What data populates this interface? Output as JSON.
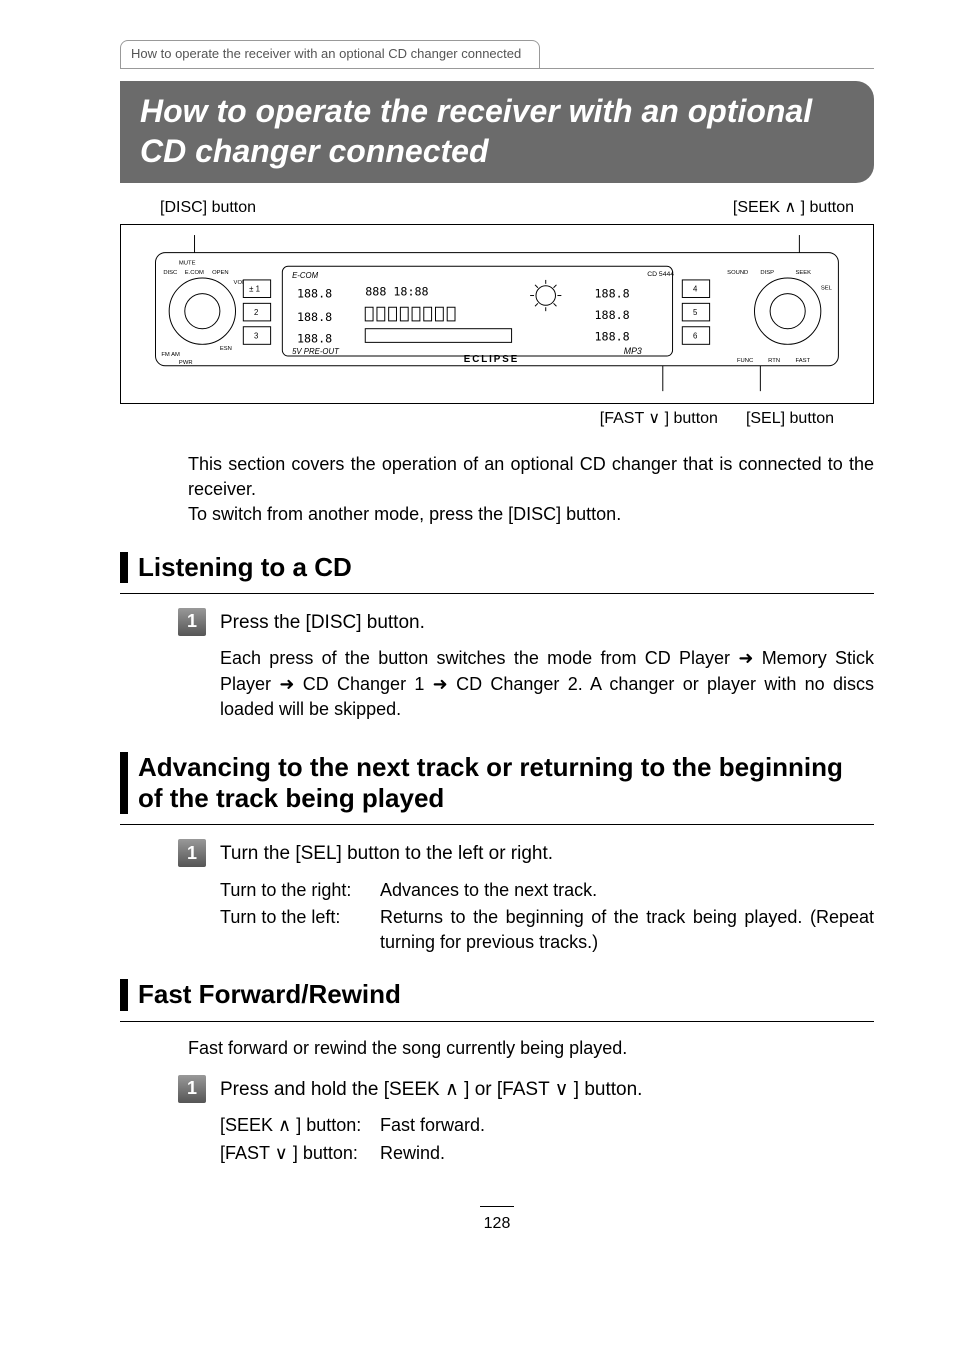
{
  "breadcrumb": "How to operate the receiver with an optional CD changer connected",
  "title": "How to operate the receiver with an optional CD changer connected",
  "callouts": {
    "top_left": "[DISC] button",
    "top_right": "[SEEK ∧ ] button",
    "bottom_left": "[FAST ∨ ] button",
    "bottom_right": "[SEL] button"
  },
  "device": {
    "model": "CD 5444",
    "brand": "ECLIPSE",
    "lcd_line": "E-COM",
    "preout": "5V PRE-OUT",
    "buttons_left_col": [
      "MUTE",
      "DISC",
      "E.COM",
      "OPEN",
      "VOL",
      "ESN",
      "FM",
      "AM",
      "PWR"
    ],
    "num_row_left": [
      "± 1",
      "2",
      "3"
    ],
    "num_row_right": [
      "4",
      "5",
      "6"
    ],
    "right_buttons": [
      "SOUND",
      "DISP",
      "SEEK",
      "SEL",
      "FUNC",
      "RTN",
      "FAST"
    ],
    "display_segments": "18:88"
  },
  "intro_para1": "This section covers the operation of an optional CD changer that is connected to the receiver.",
  "intro_para2": "To switch from another mode, press the [DISC] button.",
  "sections": {
    "listen": {
      "heading": "Listening to a CD",
      "step_label": "1",
      "step_text": "Press the [DISC] button.",
      "body": "Each press of the button switches the mode from CD  Player ➜ Memory Stick  Player ➜ CD Changer 1 ➜ CD Changer 2. A changer or player with no discs loaded will be skipped."
    },
    "advance": {
      "heading": "Advancing to the next track or returning to the beginning of the track being played",
      "step_label": "1",
      "step_text": "Turn the [SEL] button to the left or right.",
      "rows": [
        {
          "label": "Turn to the right:",
          "value": "Advances to the next track."
        },
        {
          "label": "Turn to the left:",
          "value": "Returns to the beginning of the track being played. (Repeat turning for previous tracks.)"
        }
      ]
    },
    "ffrew": {
      "heading": "Fast Forward/Rewind",
      "para": "Fast forward or rewind the song currently being played.",
      "step_label": "1",
      "step_text": "Press and hold the [SEEK ∧ ] or [FAST ∨ ] button.",
      "rows": [
        {
          "label": "[SEEK ∧ ] button:",
          "value": "Fast forward."
        },
        {
          "label": "[FAST ∨ ] button:",
          "value": "Rewind."
        }
      ]
    }
  },
  "page_number": "128"
}
